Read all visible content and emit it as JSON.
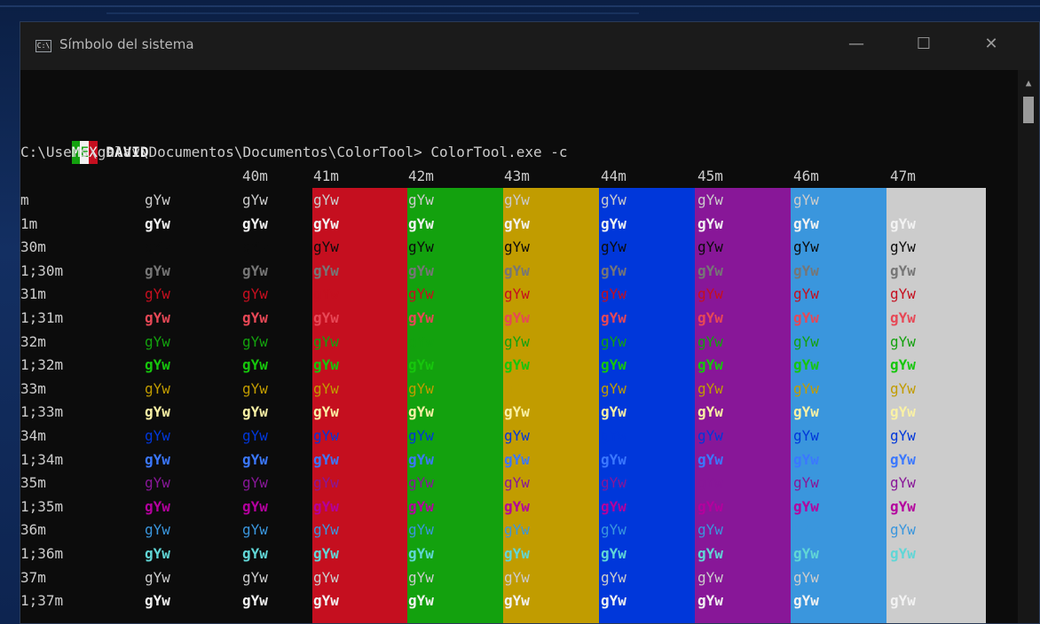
{
  "window": {
    "title": "Símbolo del sistema",
    "minimize": "—",
    "maximize": "☐",
    "close": "✕"
  },
  "console": {
    "flag": {
      "m": "M",
      "e": "E",
      "x": "X"
    },
    "user": "DAVID",
    "prompt": "C:\\Users\\galav\\Documentos\\Documentos\\ColorTool>",
    "command": "ColorTool.exe -c"
  },
  "sample_text": "gYw",
  "headers": [
    "40m",
    "41m",
    "42m",
    "43m",
    "44m",
    "45m",
    "46m",
    "47m"
  ],
  "rows": [
    "m",
    "1m",
    "30m",
    "1;30m",
    "31m",
    "1;31m",
    "32m",
    "1;32m",
    "33m",
    "1;33m",
    "34m",
    "1;34m",
    "35m",
    "1;35m",
    "36m",
    "1;36m",
    "37m",
    "1;37m"
  ],
  "colors": {
    "bg": [
      "#0c0c0c",
      "#c50f1f",
      "#13a10e",
      "#c19c00",
      "#0037da",
      "#881798",
      "#3a96dd",
      "#cccccc"
    ],
    "fg_normal": [
      "#0c0c0c",
      "#c50f1f",
      "#13a10e",
      "#c19c00",
      "#0037da",
      "#881798",
      "#3a96dd",
      "#cccccc"
    ],
    "fg_bright": [
      "#767676",
      "#e74856",
      "#16c60c",
      "#f9f1a5",
      "#3b78ff",
      "#b4009e",
      "#61d6d6",
      "#f2f2f2"
    ],
    "default_fg": "#cccccc",
    "bold_default_fg": "#f2f2f2",
    "flag": [
      "#13a10e",
      "#f2f2f2",
      "#c50f1f"
    ]
  }
}
